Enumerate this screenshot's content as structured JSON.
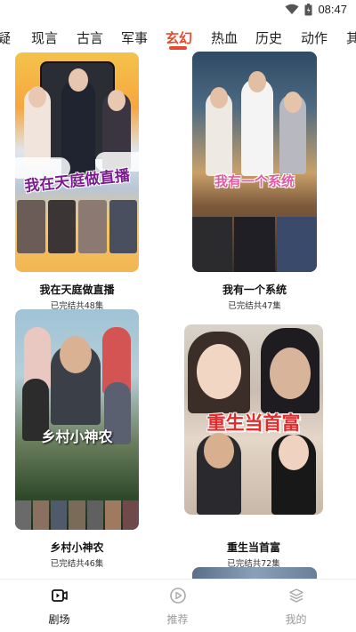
{
  "status_bar": {
    "time": "08:47",
    "icons": [
      "wifi-icon",
      "battery-icon"
    ]
  },
  "tabs": [
    {
      "label": "疑",
      "active": false
    },
    {
      "label": "现言",
      "active": false
    },
    {
      "label": "古言",
      "active": false
    },
    {
      "label": "军事",
      "active": false
    },
    {
      "label": "玄幻",
      "active": true
    },
    {
      "label": "热血",
      "active": false
    },
    {
      "label": "历史",
      "active": false
    },
    {
      "label": "动作",
      "active": false
    },
    {
      "label": "其",
      "active": false
    }
  ],
  "dramas": [
    {
      "title": "我在天庭做直播",
      "status": "已完结共48集",
      "poster_text": "我在天庭做直播"
    },
    {
      "title": "我有一个系统",
      "status": "已完结共47集",
      "poster_text": "我有一个系统"
    },
    {
      "title": "乡村小神农",
      "status": "已完结共46集",
      "poster_text": "乡村小神农"
    },
    {
      "title": "重生当首富",
      "status": "已完结共72集",
      "poster_text": "重生当首富"
    }
  ],
  "bottom_nav": [
    {
      "label": "剧场",
      "icon": "theater-icon",
      "active": true
    },
    {
      "label": "推荐",
      "icon": "play-circle-icon",
      "active": false
    },
    {
      "label": "我的",
      "icon": "layers-icon",
      "active": false
    }
  ],
  "colors": {
    "accent": "#e64a2e",
    "inactive_nav": "#999999"
  }
}
